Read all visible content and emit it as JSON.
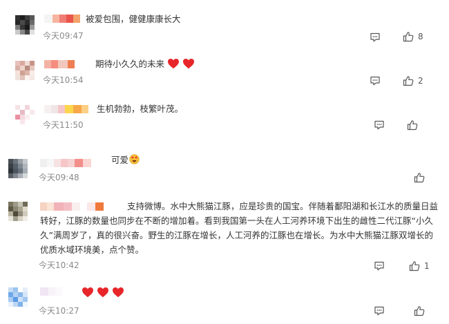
{
  "colors": {
    "time_text": "#8a8a8a",
    "comment_text": "#333333",
    "heart": "#e8262a",
    "icon_stroke": "#555555"
  },
  "comments": [
    {
      "text": "被爱包围，健健康康长大",
      "time": "今天09:47",
      "likes": "8",
      "emoji": []
    },
    {
      "text": "期待小久久的未来",
      "time": "今天10:54",
      "likes": "2",
      "emoji": [
        "red-heart",
        "red-heart"
      ]
    },
    {
      "text": "生机勃勃，枝繁叶茂。",
      "time": "今天11:50",
      "likes": "",
      "emoji": []
    },
    {
      "text": "可爱",
      "time": "今天09:48",
      "likes": "",
      "emoji": [
        "heart-eyes-face"
      ]
    },
    {
      "text": "支持微博。水中大熊猫江豚，应是珍贵的国宝。伴随着鄱阳湖和长江水的质量日益转好，江豚的数量也同步在不断的增加着。看到我国第一头在人工河养环境下出生的雌性二代江豚“小久久”满周岁了，真的很兴奋。野生的江豚在增长，人工河养的江豚也在增长。为水中大熊猫江豚双增长的优质水域环境美，点个赞。",
      "time": "今天10:42",
      "likes": "1",
      "emoji": []
    },
    {
      "text": "",
      "time": "今天10:27",
      "likes": "",
      "emoji": [
        "red-heart",
        "red-heart",
        "red-heart"
      ]
    }
  ]
}
